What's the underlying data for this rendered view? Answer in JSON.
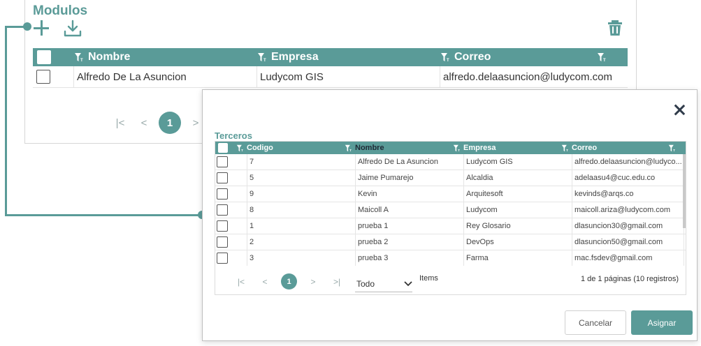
{
  "background": {
    "title": "Modulos",
    "table": {
      "headers": [
        "Nombre",
        "Empresa",
        "Correo"
      ],
      "rows": [
        {
          "nombre": "Alfredo De La Asuncion",
          "empresa": "Ludycom GIS",
          "correo": "alfredo.delaasuncion@ludycom.com"
        }
      ]
    },
    "pager": {
      "first": "|<",
      "prev": "<",
      "current": "1",
      "next": ">"
    }
  },
  "modal": {
    "title": "Terceros",
    "headers": [
      "Codigo",
      "Nombre",
      "Empresa",
      "Correo"
    ],
    "rows": [
      {
        "codigo": "7",
        "nombre": "Alfredo De La Asuncion",
        "empresa": "Ludycom GIS",
        "correo": "alfredo.delaasuncion@ludyco..."
      },
      {
        "codigo": "5",
        "nombre": "Jaime Pumarejo",
        "empresa": "Alcaldia",
        "correo": "adelaasu4@cuc.edu.co"
      },
      {
        "codigo": "9",
        "nombre": "Kevin",
        "empresa": "Arquitesoft",
        "correo": "kevinds@arqs.co"
      },
      {
        "codigo": "8",
        "nombre": "Maicoll A",
        "empresa": "Ludycom",
        "correo": "maicoll.ariza@ludycom.com"
      },
      {
        "codigo": "1",
        "nombre": "prueba 1",
        "empresa": "Rey Glosario",
        "correo": "dlasuncion30@gmail.com"
      },
      {
        "codigo": "2",
        "nombre": "prueba 2",
        "empresa": "DevOps",
        "correo": "dlasuncion50@gmail.com"
      },
      {
        "codigo": "3",
        "nombre": "prueba 3",
        "empresa": "Farma",
        "correo": "mac.fsdev@gmail.com"
      }
    ],
    "pager": {
      "first": "|<",
      "prev": "<",
      "current": "1",
      "next": ">",
      "last": ">|"
    },
    "page_size_value": "Todo",
    "items_label": "Items",
    "count_text": "1 de 1 páginas (10 registros)",
    "cancel_label": "Cancelar",
    "assign_label": "Asignar"
  },
  "colors": {
    "accent": "#5a9b98",
    "title_accent": "#5b9b98"
  },
  "icons": [
    "add-icon",
    "download-icon",
    "trash-icon",
    "filter-icon",
    "close-icon",
    "chevron-down-icon"
  ]
}
